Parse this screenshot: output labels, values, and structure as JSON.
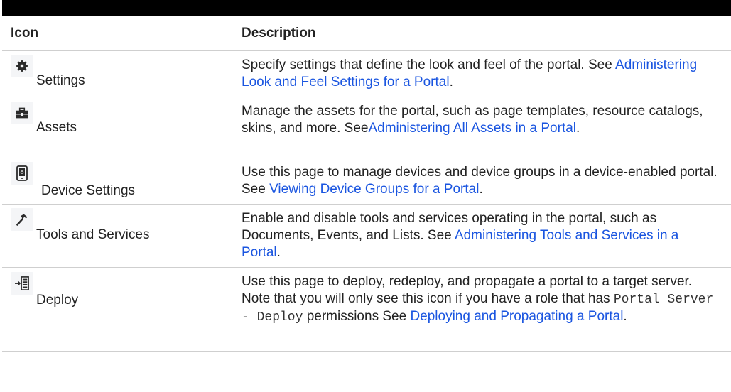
{
  "headers": {
    "icon": "Icon",
    "description": "Description"
  },
  "rows": {
    "settings": {
      "icon_name": "gear-icon",
      "label": "Settings",
      "text": "Specify settings that define the look and feel of the portal. See ",
      "link": "Administering Look and Feel Settings for a Portal",
      "end": "."
    },
    "assets": {
      "icon_name": "toolbox-icon",
      "label": "Assets",
      "text": "Manage the assets for the portal, such as page templates, resource catalogs, skins, and more. See",
      "link": "Administering All Assets in a Portal",
      "end": "."
    },
    "device": {
      "icon_name": "tablet-icon",
      "label": "Device Settings",
      "text": "Use this page to manage devices and device groups in a device-enabled portal. See ",
      "link": "Viewing Device Groups for a Portal",
      "end": "."
    },
    "tools": {
      "icon_name": "hammer-icon",
      "label": "Tools and Services",
      "text": "Enable and disable tools and services operating in the portal, such as Documents, Events, and Lists. See ",
      "link": "Administering Tools and Services in a Portal",
      "end": "."
    },
    "deploy": {
      "icon_name": "deploy-icon",
      "label": "Deploy",
      "text": "Use this page to deploy, redeploy, and propagate a portal to a target server. Note that you will only see this icon if you have a role that has ",
      "code": "Portal Server - Deploy",
      "text2": " permissions See ",
      "link": "Deploying and Propagating a Portal",
      "end": "."
    }
  },
  "colors": {
    "link": "#1a55e0",
    "icon": "#2b2b2b",
    "icon_bg": "#f4f5f7"
  }
}
